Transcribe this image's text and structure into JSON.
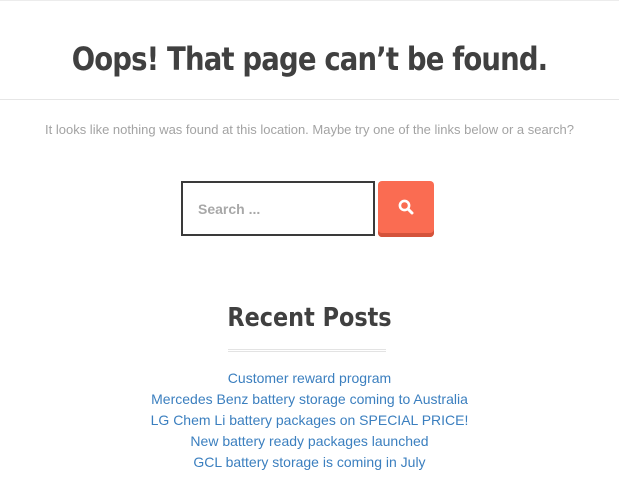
{
  "header": {
    "title": "Oops! That page can’t be found."
  },
  "main": {
    "notice": "It looks like nothing was found at this location. Maybe try one of the links below or a search?",
    "search": {
      "placeholder": "Search ...",
      "value": "",
      "button_icon": "search-icon"
    },
    "recent_posts": {
      "title": "Recent Posts",
      "items": [
        "Customer reward program",
        "Mercedes Benz battery storage coming to Australia",
        "LG Chem Li battery packages on SPECIAL PRICE!",
        "New battery ready packages launched",
        "GCL battery storage is coming in July"
      ]
    }
  },
  "colors": {
    "accent": "#fa6c52",
    "link": "#3b7fbf",
    "heading": "#404040",
    "muted_text": "#a3a3a3"
  }
}
